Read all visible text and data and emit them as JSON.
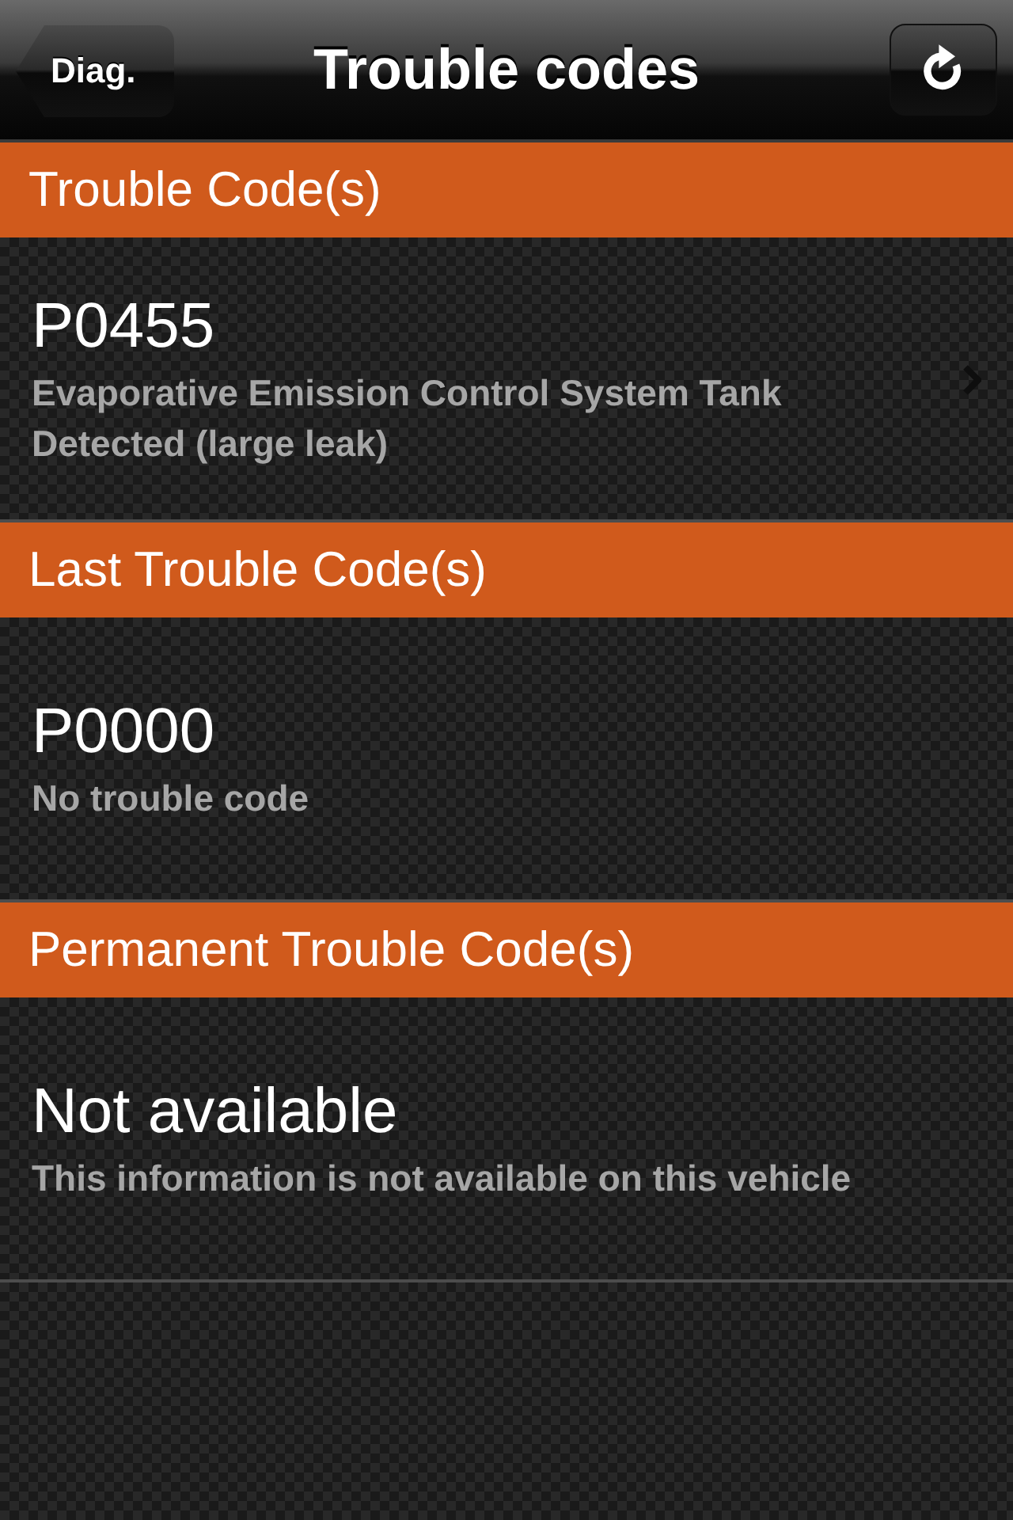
{
  "nav_bar": {
    "back_button": "Diag.",
    "title": "Trouble codes"
  },
  "sections": [
    {
      "header": "Trouble Code(s)",
      "rows": [
        {
          "code": "P0455",
          "description": "Evaporative Emission Control System Tank Detected (large leak)",
          "disclosure": true
        }
      ]
    },
    {
      "header": "Last Trouble Code(s)",
      "rows": [
        {
          "code": "P0000",
          "description": "No trouble code",
          "disclosure": false
        }
      ]
    },
    {
      "header": "Permanent Trouble Code(s)",
      "rows": [
        {
          "code": "Not available",
          "description": "This information is not available on this vehicle",
          "disclosure": false
        }
      ]
    }
  ]
}
